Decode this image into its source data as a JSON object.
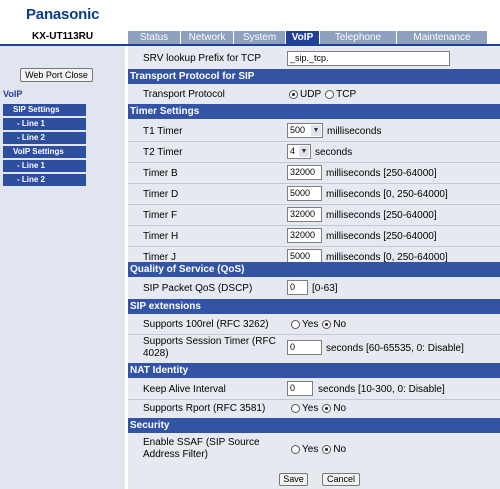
{
  "header": {
    "brand": "Panasonic",
    "model": "KX-UT113RU",
    "tabs": [
      {
        "label": "Status"
      },
      {
        "label": "Network"
      },
      {
        "label": "System"
      },
      {
        "label": "VoIP",
        "active": true
      },
      {
        "label": "Telephone"
      },
      {
        "label": "Maintenance"
      }
    ]
  },
  "sidebar": {
    "web_port_close": "Web Port Close",
    "section": "VoIP",
    "items": [
      {
        "label": "SIP Settings"
      },
      {
        "label": "- Line 1"
      },
      {
        "label": "- Line 2"
      },
      {
        "label": "VoIP Settings"
      },
      {
        "label": "- Line 1"
      },
      {
        "label": "- Line 2"
      }
    ]
  },
  "main": {
    "srv_lookup": {
      "label": "SRV lookup Prefix for TCP",
      "value": "_sip._tcp."
    },
    "transport_section": "Transport Protocol for SIP",
    "transport": {
      "label": "Transport Protocol",
      "options": [
        "UDP",
        "TCP"
      ],
      "selected": "UDP"
    },
    "timer_section": "Timer Settings",
    "t1": {
      "label": "T1 Timer",
      "value": "500",
      "unit": "milliseconds"
    },
    "t2": {
      "label": "T2 Timer",
      "value": "4",
      "unit": "seconds"
    },
    "timer_b": {
      "label": "Timer B",
      "value": "32000",
      "unit": "milliseconds [250-64000]"
    },
    "timer_d": {
      "label": "Timer D",
      "value": "5000",
      "unit": "milliseconds [0, 250-64000]"
    },
    "timer_f": {
      "label": "Timer F",
      "value": "32000",
      "unit": "milliseconds [250-64000]"
    },
    "timer_h": {
      "label": "Timer H",
      "value": "32000",
      "unit": "milliseconds [250-64000]"
    },
    "timer_j": {
      "label": "Timer J",
      "value": "5000",
      "unit": "milliseconds [0, 250-64000]"
    },
    "qos_section": "Quality of Service (QoS)",
    "sip_qos": {
      "label": "SIP Packet QoS (DSCP)",
      "value": "0",
      "unit": "[0-63]"
    },
    "ext_section": "SIP extensions",
    "rel100": {
      "label": "Supports 100rel (RFC 3262)",
      "options": [
        "Yes",
        "No"
      ],
      "selected": "No"
    },
    "session_timer": {
      "label_line1": "Supports Session Timer (RFC",
      "label_line2": "4028)",
      "value": "0",
      "unit": "seconds [60-65535, 0: Disable]"
    },
    "nat_section": "NAT Identity",
    "keep_alive": {
      "label": "Keep Alive Interval",
      "value": "0",
      "unit": "seconds [10-300, 0: Disable]"
    },
    "rport": {
      "label": "Supports Rport (RFC 3581)",
      "options": [
        "Yes",
        "No"
      ],
      "selected": "No"
    },
    "security_section": "Security",
    "ssaf": {
      "label_line1": "Enable SSAF (SIP Source",
      "label_line2": "Address Filter)",
      "options": [
        "Yes",
        "No"
      ],
      "selected": "No"
    },
    "save_label": "Save",
    "cancel_label": "Cancel"
  },
  "colors": {
    "brand": "#0b3c8c",
    "section_header": "#3354a4",
    "tab_active": "#21409a",
    "tab": "#8e9fbf",
    "panel": "#e6e9f0",
    "sidebar": "#e1e5ef"
  }
}
